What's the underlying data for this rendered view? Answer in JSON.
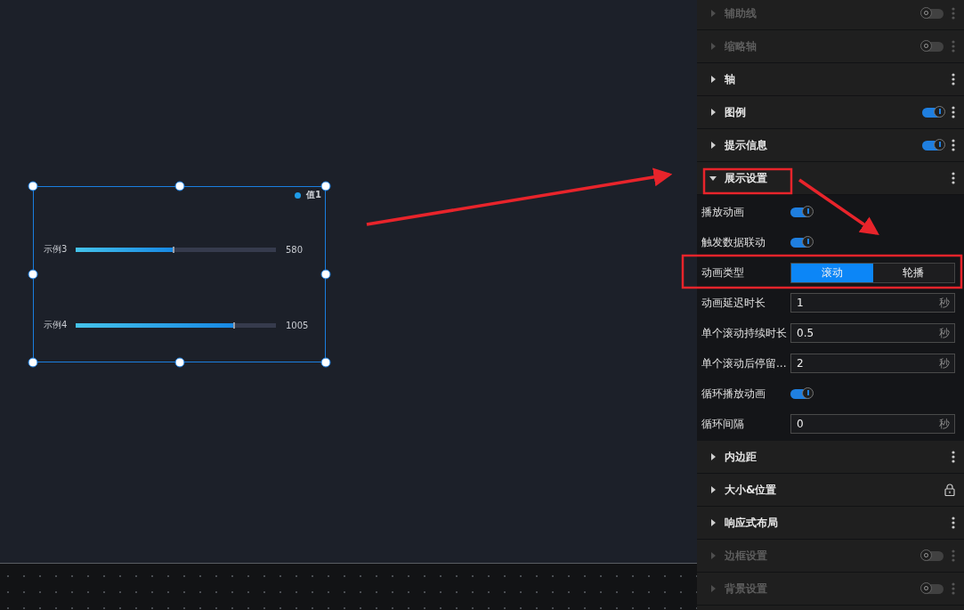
{
  "canvas": {
    "widget": {
      "legend": {
        "label": "值1",
        "color": "#1e9be8"
      },
      "rows": [
        {
          "label": "示例3",
          "level": 0.49,
          "value": "580"
        },
        {
          "label": "示例4",
          "level": 0.79,
          "value": "1005"
        }
      ]
    }
  },
  "panel": {
    "sections": [
      {
        "title": "辅助线",
        "disabled": true,
        "expanded": false,
        "kind": "toggle",
        "on": false
      },
      {
        "title": "缩略轴",
        "disabled": true,
        "expanded": false,
        "kind": "toggle",
        "on": false
      },
      {
        "title": "轴",
        "disabled": false,
        "expanded": false,
        "kind": "menu"
      },
      {
        "title": "图例",
        "disabled": false,
        "expanded": false,
        "kind": "toggle",
        "on": true
      },
      {
        "title": "提示信息",
        "disabled": false,
        "expanded": false,
        "kind": "toggle",
        "on": true
      },
      {
        "title": "展示设置",
        "disabled": false,
        "expanded": true,
        "kind": "menu",
        "fields": [
          {
            "kind": "toggle",
            "label": "播放动画",
            "on": true
          },
          {
            "kind": "toggle",
            "label": "触发数据联动",
            "on": true
          },
          {
            "kind": "segmented",
            "label": "动画类型",
            "options": [
              {
                "label": "滚动",
                "selected": true
              },
              {
                "label": "轮播",
                "selected": false
              }
            ]
          },
          {
            "kind": "number",
            "label": "动画延迟时长",
            "value": "1",
            "unit": "秒"
          },
          {
            "kind": "number",
            "label": "单个滚动持续时长",
            "value": "0.5",
            "unit": "秒"
          },
          {
            "kind": "number",
            "label": "单个滚动后停留...",
            "value": "2",
            "unit": "秒"
          },
          {
            "kind": "toggle",
            "label": "循环播放动画",
            "on": true
          },
          {
            "kind": "number",
            "label": "循环间隔",
            "value": "0",
            "unit": "秒"
          }
        ]
      },
      {
        "title": "内边距",
        "disabled": false,
        "expanded": false,
        "kind": "menu"
      },
      {
        "title": "大小&位置",
        "disabled": false,
        "expanded": false,
        "kind": "lock"
      },
      {
        "title": "响应式布局",
        "disabled": false,
        "expanded": false,
        "kind": "menu"
      },
      {
        "title": "边框设置",
        "disabled": true,
        "expanded": false,
        "kind": "toggle",
        "on": false
      },
      {
        "title": "背景设置",
        "disabled": true,
        "expanded": false,
        "kind": "toggle",
        "on": false
      }
    ]
  }
}
